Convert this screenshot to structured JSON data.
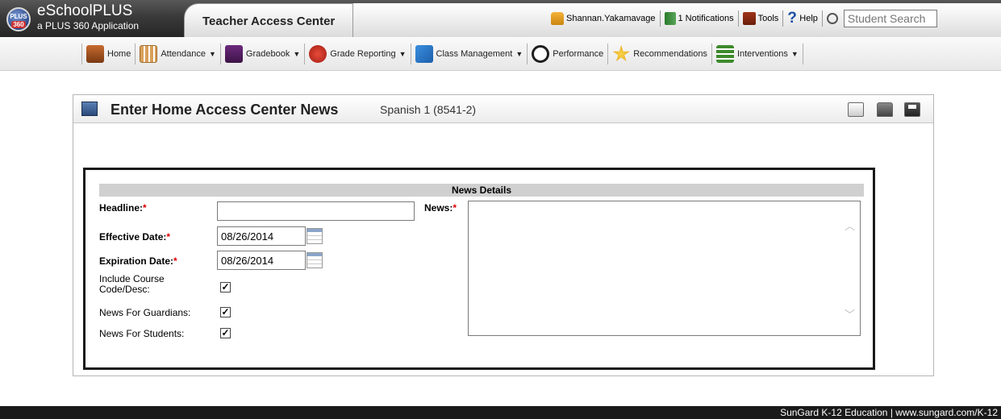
{
  "header": {
    "logo_top": "PLUS",
    "logo_bottom": "360",
    "app_name": "eSchoolPLUS",
    "app_subtitle": "a PLUS 360 Application",
    "tab_title": "Teacher Access Center",
    "username": "Shannan.Yakamavage",
    "notifications_label": "1 Notifications",
    "tools_label": "Tools",
    "help_label": "Help",
    "help_glyph": "?",
    "search_placeholder": "Student Search"
  },
  "nav": {
    "items": [
      {
        "label": "Home",
        "icon": "home-icon",
        "dropdown": false
      },
      {
        "label": "Attendance",
        "icon": "attendance-icon",
        "dropdown": true
      },
      {
        "label": "Gradebook",
        "icon": "gradebook-icon",
        "dropdown": true
      },
      {
        "label": "Grade Reporting",
        "icon": "grade-reporting-icon",
        "dropdown": true
      },
      {
        "label": "Class Management",
        "icon": "class-management-icon",
        "dropdown": true
      },
      {
        "label": "Performance",
        "icon": "performance-icon",
        "dropdown": false
      },
      {
        "label": "Recommendations",
        "icon": "recommendations-icon",
        "dropdown": false
      },
      {
        "label": "Interventions",
        "icon": "interventions-icon",
        "dropdown": true
      }
    ],
    "caret": "▼"
  },
  "panel": {
    "title": "Enter Home Access Center News",
    "course": "Spanish 1 (8541-2)"
  },
  "form": {
    "section_title": "News Details",
    "required_marker": "*",
    "headline_label": "Headline:",
    "headline_value": "",
    "effective_date_label": "Effective Date:",
    "effective_date_value": "08/26/2014",
    "expiration_date_label": "Expiration Date:",
    "expiration_date_value": "08/26/2014",
    "include_course_label": "Include Course Code/Desc:",
    "include_course_checked": true,
    "guardians_label": "News For Guardians:",
    "guardians_checked": true,
    "students_label": "News For Students:",
    "students_checked": true,
    "news_label": "News:",
    "news_value": "",
    "check_glyph": "✓"
  },
  "footer": {
    "text": "SunGard K-12 Education | www.sungard.com/K-12"
  },
  "colors": {
    "header_dark": "#3a3a3a",
    "required": "#dd0000",
    "section_bar": "#d0d0d0"
  }
}
